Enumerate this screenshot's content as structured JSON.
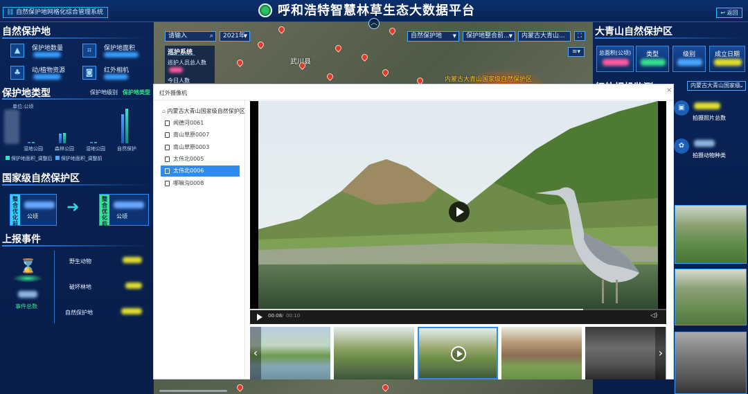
{
  "header": {
    "system_tab": "自然保护地网格化综合管理系统",
    "title": "呼和浩特智慧林草生态大数据平台",
    "back_label": "返回"
  },
  "left": {
    "nature_reserve": {
      "title": "自然保护地",
      "stats": [
        {
          "label": "保护地数量",
          "icon": "mountain-icon"
        },
        {
          "label": "保护地面积",
          "icon": "area-icon"
        },
        {
          "label": "动/植物资源",
          "icon": "plant-icon"
        },
        {
          "label": "红外相机",
          "icon": "camera-icon"
        }
      ]
    },
    "reserve_type": {
      "title": "保护地类型",
      "tab_level": "保护地级别",
      "tab_type": "保护地类型",
      "unit": "单位:公顷",
      "categories": [
        "湿地公园",
        "森林公园",
        "湿地公园",
        "自然保护"
      ],
      "values": [
        0.05,
        0.3,
        0.05,
        1.0
      ],
      "values2": [
        0.02,
        0.28,
        0.02,
        0.85
      ],
      "legend1": "保护地面积_调整后",
      "legend2": "保护地面积_调整前"
    },
    "national": {
      "title": "国家级自然保护区",
      "left_tab": "整合优化前",
      "right_tab": "整合优化后",
      "unit": "公顷",
      "unit2": "公顷"
    },
    "events": {
      "title": "上报事件",
      "total_label": "事件总数",
      "items": [
        "野生动物",
        "破坏林地",
        "自然保护地"
      ]
    }
  },
  "map": {
    "search_placeholder": "请输入",
    "year": "2021年",
    "filter1": "自然保护地",
    "filter2": "保护地整合前...",
    "filter3": "内蒙古大青山...",
    "patrol_title": "巡护系统",
    "patrol_total": "巡护人员总人数",
    "patrol_today": "今日人数",
    "county_label": "武川县",
    "zone_label": "内蒙古大青山国家级自然保护区"
  },
  "right": {
    "title": "大青山自然保护区",
    "tabs": [
      "总面积(公顷)",
      "类型",
      "级别",
      "成立日期"
    ],
    "monitor_title": "红外相机监测",
    "select": "内蒙古大青山国家级",
    "photo_count": "拍摄照片总数",
    "species_count": "拍摄动物种类"
  },
  "modal": {
    "title": "红外摄像机",
    "tree_root": "内蒙古大青山国家级自然保护区",
    "cameras": [
      "闻德河0061",
      "南山草原0007",
      "南山草原0003",
      "太伟北0005",
      "太伟北0006",
      "哪嘛沟0008"
    ],
    "selected_index": 4,
    "video": {
      "current_time": "00:08",
      "separator": "/",
      "total_time": "00:10",
      "progress": 0.8
    }
  }
}
